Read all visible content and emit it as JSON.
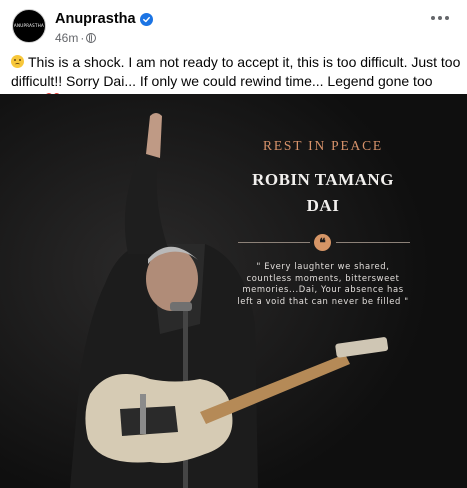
{
  "post": {
    "author": "Anuprastha",
    "avatar_text": "ANUPRASTHA",
    "time": "46m",
    "separator": "·",
    "caption": "This is a shock. I am not ready to accept it, this is too difficult. Just too difficult!! Sorry Dai... If only we could rewind time... Legend gone too soon",
    "heart_emoji": "💔"
  },
  "image": {
    "heading": "REST IN PEACE",
    "name_line1": "ROBIN TAMANG",
    "name_line2": "DAI",
    "quote_mark": "❝",
    "quote": "\" Every laughter we shared, countless moments, bittersweet memories...Dai, Your absence has left a void that can never be filled \""
  },
  "icons": [
    "verified-icon",
    "globe-icon",
    "more-options-icon",
    "sad-emoji-icon",
    "broken-heart-icon"
  ],
  "colors": {
    "verified": "#1b74e4",
    "accent": "#d7926a",
    "photo_bg": "#131212",
    "meta": "#65676b"
  }
}
